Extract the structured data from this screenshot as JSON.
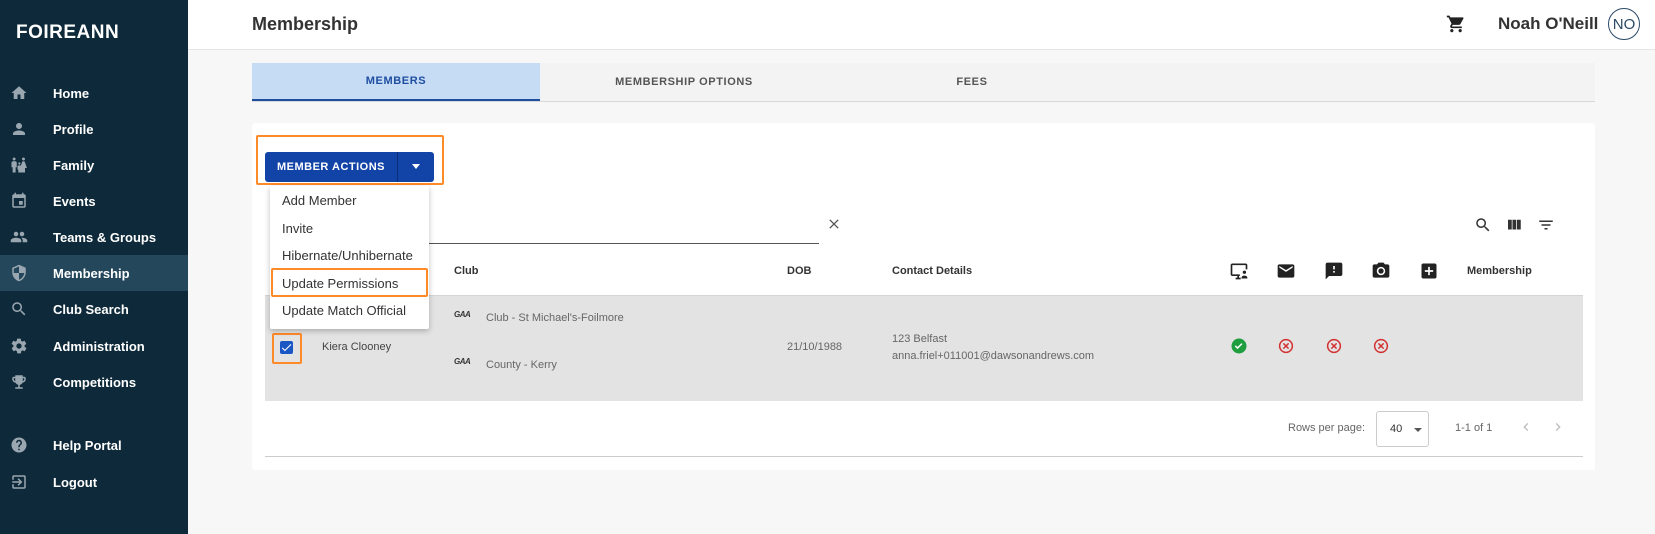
{
  "sidebar": {
    "logo": "FOIREANN",
    "items": [
      {
        "label": "Home",
        "icon": "home-icon"
      },
      {
        "label": "Profile",
        "icon": "person-icon"
      },
      {
        "label": "Family",
        "icon": "family-icon"
      },
      {
        "label": "Events",
        "icon": "calendar-icon"
      },
      {
        "label": "Teams & Groups",
        "icon": "group-icon"
      },
      {
        "label": "Membership",
        "icon": "shield-icon",
        "active": true
      },
      {
        "label": "Club Search",
        "icon": "search-icon"
      },
      {
        "label": "Administration",
        "icon": "gear-icon"
      },
      {
        "label": "Competitions",
        "icon": "trophy-icon"
      },
      {
        "label": "Help Portal",
        "icon": "help-icon"
      },
      {
        "label": "Logout",
        "icon": "logout-icon"
      }
    ]
  },
  "header": {
    "title": "Membership",
    "user_name": "Noah O'Neill",
    "avatar_initials": "NO"
  },
  "tabs": [
    {
      "label": "MEMBERS",
      "active": true
    },
    {
      "label": "MEMBERSHIP OPTIONS",
      "active": false
    },
    {
      "label": "FEES",
      "active": false
    }
  ],
  "member_actions": {
    "label": "MEMBER ACTIONS",
    "menu": [
      "Add Member",
      "Invite",
      "Hibernate/Unhibernate",
      "Update Permissions",
      "Update Match Official"
    ],
    "highlighted_item": "Update Permissions"
  },
  "search": {
    "value": "",
    "placeholder": ""
  },
  "table": {
    "headers": {
      "club": "Club",
      "dob": "DOB",
      "contact": "Contact Details",
      "membership": "Membership"
    },
    "status_column_icons": [
      "monitor-person-icon",
      "mail-icon",
      "alert-icon",
      "camera-icon",
      "medical-icon"
    ],
    "rows": [
      {
        "selected": true,
        "name": "Kiera Clooney",
        "gaa_badge": "GAA",
        "club_1": "Club - St Michael's-Foilmore",
        "club_2": "County - Kerry",
        "dob": "21/10/1988",
        "address": "123 Belfast",
        "email": "anna.friel+011001@dawsonandrews.com",
        "statuses": [
          "check",
          "x",
          "x",
          "x"
        ]
      }
    ]
  },
  "pagination": {
    "rows_per_page_label": "Rows per page:",
    "rows_per_page": "40",
    "range": "1-1 of 1"
  },
  "colors": {
    "sidebar": "#0e2a3a",
    "primary": "#1244a8",
    "highlight": "#ff8a2a",
    "success": "#1e9e3e",
    "error": "#d32f2f"
  }
}
